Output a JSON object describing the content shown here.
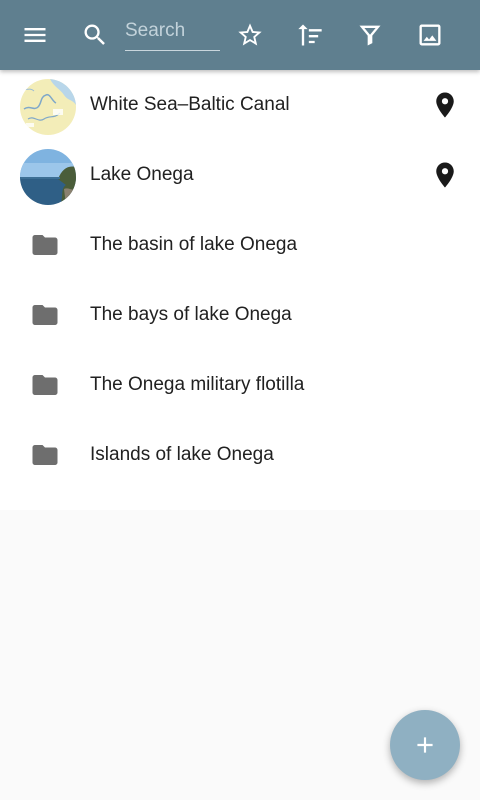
{
  "toolbar": {
    "color": "#5f7f8f",
    "search_placeholder": "Search",
    "search_value": "",
    "icons": [
      "menu-icon",
      "search-icon",
      "star-outline-icon",
      "sort-icon",
      "filter-icon",
      "image-icon"
    ]
  },
  "list": {
    "items": [
      {
        "label": "White Sea–Baltic Canal",
        "type": "place",
        "thumbnail": "map-thumbnail",
        "pin": true
      },
      {
        "label": "Lake Onega",
        "type": "place",
        "thumbnail": "lake-photo-thumbnail",
        "pin": true
      },
      {
        "label": "The basin of lake Onega",
        "type": "folder",
        "pin": false
      },
      {
        "label": "The bays of lake Onega",
        "type": "folder",
        "pin": false
      },
      {
        "label": "The Onega military flotilla",
        "type": "folder",
        "pin": false
      },
      {
        "label": "Islands of lake Onega",
        "type": "folder",
        "pin": false
      }
    ]
  },
  "fab": {
    "icon": "plus-icon",
    "color": "#8fb0c2"
  }
}
